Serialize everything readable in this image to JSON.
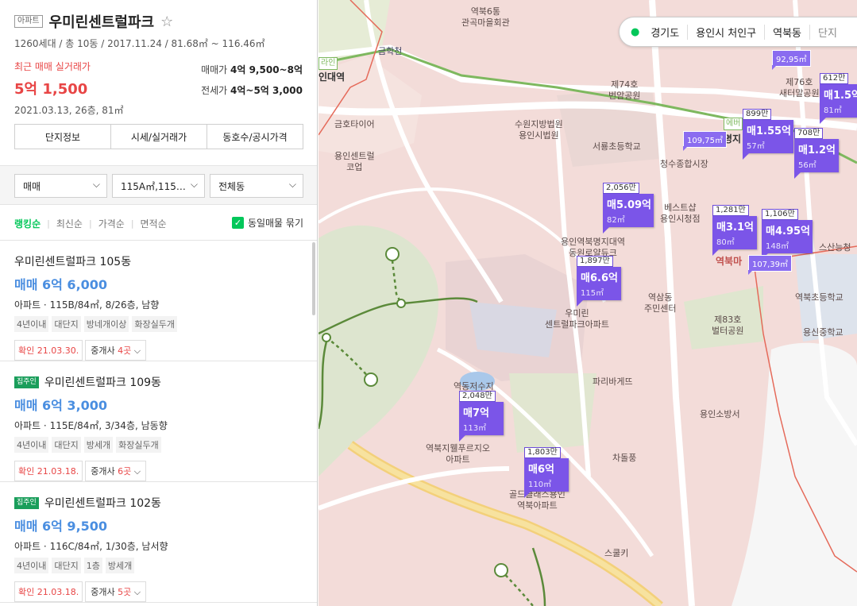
{
  "complex": {
    "type_tag": "아파트",
    "name": "우미린센트럴파크",
    "meta": "1260세대 / 총 10동 / 2017.11.24 / 81.68㎡ ~ 116.46㎡",
    "recent_label": "최근 매매 실거래가",
    "recent_price": "5억 1,500",
    "recent_date": "2021.03.13, 26층, 81㎡",
    "sale_label": "매매가",
    "sale_value": "4억 9,500~8억",
    "jeonse_label": "전세가",
    "jeonse_value": "4억~5억 3,000"
  },
  "tabs": [
    "단지정보",
    "시세/실거래가",
    "동호수/공시가격"
  ],
  "filters": {
    "trade": "매매",
    "area": "115A㎡,115…",
    "building": "전체동"
  },
  "sort": {
    "options": [
      "랭킹순",
      "최신순",
      "가격순",
      "면적순"
    ],
    "group_label": "동일매물 묶기"
  },
  "listings": [
    {
      "badge": "",
      "title": "우미린센트럴파크 105동",
      "price": "매매 6억 6,000",
      "desc": "아파트 · 115B/84㎡, 8/26층, 남향",
      "tags": [
        "4년이내",
        "대단지",
        "방네개이상",
        "화장실두개"
      ],
      "confirm": "확인 21.03.30.",
      "agents_prefix": "중개사 ",
      "agents_count": "4곳"
    },
    {
      "badge": "집주인",
      "title": "우미린센트럴파크 109동",
      "price": "매매 6억 3,000",
      "desc": "아파트 · 115E/84㎡, 3/34층, 남동향",
      "tags": [
        "4년이내",
        "대단지",
        "방세개",
        "화장실두개"
      ],
      "confirm": "확인 21.03.18.",
      "agents_prefix": "중개사 ",
      "agents_count": "6곳"
    },
    {
      "badge": "집주인",
      "title": "우미린센트럴파크 102동",
      "price": "매매 6억 9,500",
      "desc": "아파트 · 116C/84㎡, 1/30층, 남서향",
      "tags": [
        "4년이내",
        "대단지",
        "1층",
        "방세개"
      ],
      "confirm": "확인 21.03.18.",
      "agents_prefix": "중개사 ",
      "agents_count": "5곳"
    }
  ],
  "location": [
    "경기도",
    "용인시 처인구",
    "역북동",
    "단지"
  ],
  "map_labels": {
    "l1": "역북6통\n관곡마을회관",
    "l2": "금학천",
    "l3": "인대역",
    "l4": "라인",
    "l5": "제74호\n번암공원",
    "l6": "수원지방법원\n용인시법원",
    "l7": "금호타이어",
    "l8": "용인센트럴\n코업",
    "l9": "서룡초등학교",
    "l10": "청수종합시장",
    "l11": "명지",
    "l12": "에버",
    "l13": "제76호\n새터말공원",
    "l14": "용인역북명지대역\n동원로얄듀크",
    "l15": "베스트샵\n용인시청점",
    "l16": "역북마",
    "l17": "우미린\n센트럴파크아파트",
    "l18": "역삼동\n주민센터",
    "l19": "제83호\n벌터공원",
    "l20": "역북초등학교",
    "l21": "용신중학교",
    "l22": "파리바게뜨",
    "l23": "역동저수지",
    "l24": "용인소방서",
    "l25": "역북지웰푸르지오\n아파트",
    "l26": "차돌풍",
    "l27": "골드클래스용인\n역북아파트",
    "l28": "스쿨키",
    "l29": "스산능청"
  },
  "markers": [
    {
      "count": "2,056만",
      "price": "매5.09억",
      "area": "82㎡"
    },
    {
      "count": "1,897만",
      "price": "매6.6억",
      "area": "115㎡"
    },
    {
      "count": "2,048만",
      "price": "매7억",
      "area": "113㎡"
    },
    {
      "count": "1,803만",
      "price": "매6억",
      "area": "110㎡"
    },
    {
      "count": "899만",
      "price": "매1.55억",
      "area": "57㎡"
    },
    {
      "count": "708만",
      "price": "매1.2억",
      "area": "56㎡"
    },
    {
      "count": "612만",
      "price": "매1.5억",
      "area": "81㎡"
    },
    {
      "count": "1,281만",
      "price": "매3.1억",
      "area": "80㎡"
    },
    {
      "count": "1,106만",
      "price": "매4.95억",
      "area": "148㎡"
    }
  ],
  "pills": [
    "92,95㎡",
    "109,75㎡",
    "107,39㎡"
  ],
  "colors": {
    "accent_green": "#03c75a",
    "price_red": "#e84545",
    "price_blue": "#4a8ee0",
    "marker_purple": "#7b55e8",
    "map_bg": "#f3dcd9"
  }
}
